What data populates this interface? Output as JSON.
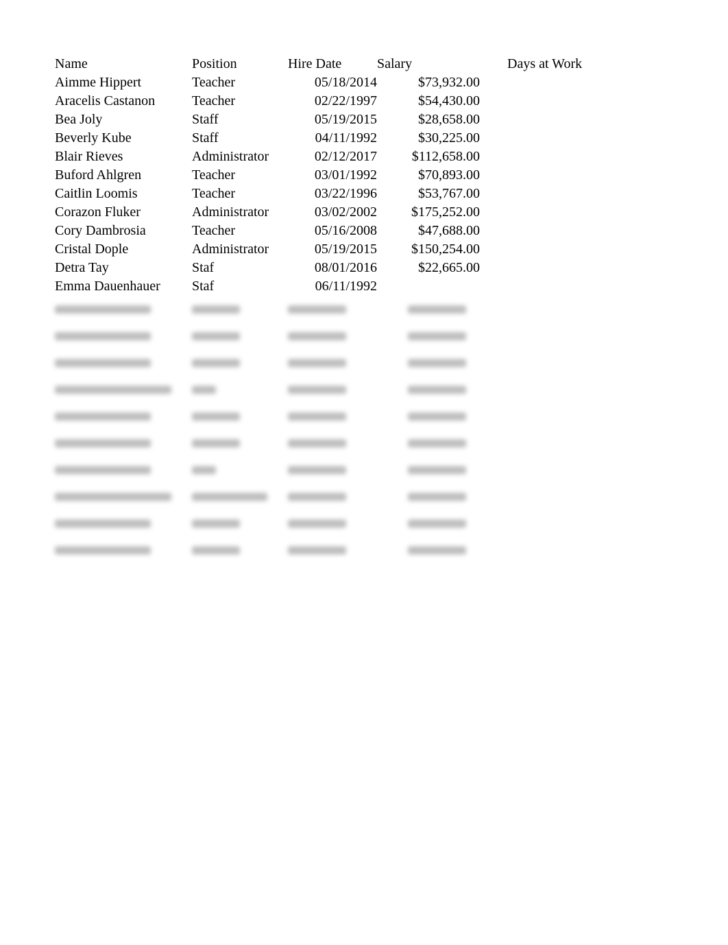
{
  "headers": {
    "name": "Name",
    "position": "Position",
    "hire_date": "Hire Date",
    "salary": "Salary",
    "days_at_work": "Days at Work"
  },
  "rows": [
    {
      "name": "Aimme Hippert",
      "position": "Teacher",
      "hire_date": "05/18/2014",
      "salary": "$73,932.00",
      "days_at_work": ""
    },
    {
      "name": "Aracelis Castanon",
      "position": "Teacher",
      "hire_date": "02/22/1997",
      "salary": "$54,430.00",
      "days_at_work": ""
    },
    {
      "name": "Bea Joly",
      "position": "Staff",
      "hire_date": "05/19/2015",
      "salary": "$28,658.00",
      "days_at_work": ""
    },
    {
      "name": "Beverly Kube",
      "position": "Staff",
      "hire_date": "04/11/1992",
      "salary": "$30,225.00",
      "days_at_work": ""
    },
    {
      "name": "Blair Rieves",
      "position": "Administrator",
      "hire_date": "02/12/2017",
      "salary": "$112,658.00",
      "days_at_work": ""
    },
    {
      "name": "Buford Ahlgren",
      "position": "Teacher",
      "hire_date": "03/01/1992",
      "salary": "$70,893.00",
      "days_at_work": ""
    },
    {
      "name": "Caitlin Loomis",
      "position": "Teacher",
      "hire_date": "03/22/1996",
      "salary": "$53,767.00",
      "days_at_work": ""
    },
    {
      "name": "Corazon Fluker",
      "position": "Administrator",
      "hire_date": "03/02/2002",
      "salary": "$175,252.00",
      "days_at_work": ""
    },
    {
      "name": "Cory Dambrosia",
      "position": "Teacher",
      "hire_date": "05/16/2008",
      "salary": "$47,688.00",
      "days_at_work": ""
    },
    {
      "name": "Cristal Dople",
      "position": "Administrator",
      "hire_date": "05/19/2015",
      "salary": "$150,254.00",
      "days_at_work": ""
    },
    {
      "name": "Detra Tay",
      "position": "Staf",
      "hire_date": "08/01/2016",
      "salary": "$22,665.00",
      "days_at_work": ""
    },
    {
      "name": "Emma Dauenhauer",
      "position": "Staf",
      "hire_date": "06/11/1992",
      "salary": "",
      "days_at_work": ""
    }
  ],
  "obscured_rows_count": 10
}
